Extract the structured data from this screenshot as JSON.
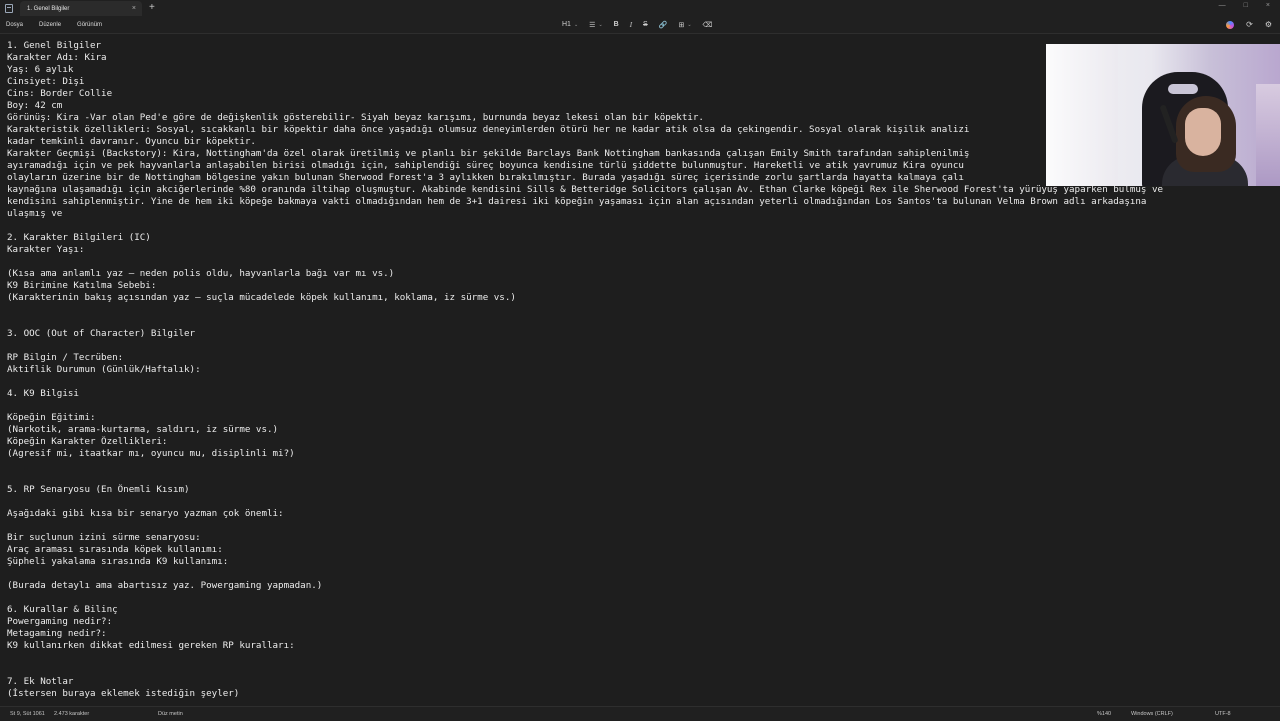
{
  "window": {
    "tab_title": "1. Genel Bilgiler",
    "tab_close": "×",
    "new_tab": "+",
    "controls": [
      "—",
      "□",
      "×"
    ]
  },
  "menu": [
    "Dosya",
    "Düzenle",
    "Görünüm"
  ],
  "toolbar": {
    "heading": "H1",
    "list": "☰",
    "bold": "B",
    "italic": "I",
    "strike": "S",
    "link": "🔗",
    "table": "⊞",
    "clear": "⌫",
    "chevron": "⌄"
  },
  "right_tools": [
    "⟳",
    "⚙"
  ],
  "document": {
    "lines": [
      "1. Genel Bilgiler",
      "Karakter Adı: Kira",
      "Yaş: 6 aylık",
      "Cinsiyet: Dişi",
      "Cins: Border Collie",
      "Boy: 42 cm",
      "Görünüş: Kira -Var olan Ped'e göre de değişkenlik gösterebilir- Siyah beyaz karışımı, burnunda beyaz lekesi olan bir köpektir.",
      "Karakteristik özellikleri: Sosyal, sıcakkanlı bir köpektir daha önce yaşadığı olumsuz deneyimlerden ötürü her ne kadar atik olsa da çekingendir. Sosyal olarak kişilik analizi",
      "kadar temkinli davranır. Oyuncu bir köpektir.",
      "Karakter Geçmişi (Backstory): Kira, Nottingham'da özel olarak üretilmiş ve planlı bir şekilde Barclays Bank Nottingham bankasında çalışan Emily Smith tarafından sahiplenilmiş",
      "ayıramadığı için ve pek hayvanlarla anlaşabilen birisi olmadığı için, sahiplendiği süreç boyunca kendisine türlü şiddette bulunmuştur. Hareketli ve atik yavrumuz Kira oyuncu",
      "olayların üzerine bir de Nottingham bölgesine yakın bulunan Sherwood Forest'a 3 aylıkken bırakılmıştır. Burada yaşadığı süreç içerisinde zorlu şartlarda hayatta kalmaya çalı",
      "kaynağına ulaşamadığı için akciğerlerinde %80 oranında iltihap oluşmuştur. Akabinde kendisini Sills & Betteridge Solicitors çalışan Av. Ethan Clarke köpeği Rex ile Sherwood Forest'ta yürüyüş yaparken bulmuş ve",
      "kendisini sahiplenmiştir. Yine de hem iki köpeğe bakmaya vakti olmadığından hem de 3+1 dairesi iki köpeğin yaşaması için alan açısından yeterli olmadığından Los Santos'ta bulunan Velma Brown adlı arkadaşına",
      "ulaşmış ve",
      "",
      "2. Karakter Bilgileri (IC)",
      "Karakter Yaşı:",
      "",
      "(Kısa ama anlamlı yaz — neden polis oldu, hayvanlarla bağı var mı vs.)",
      "K9 Birimine Katılma Sebebi:",
      "(Karakterinin bakış açısından yaz — suçla mücadelede köpek kullanımı, koklama, iz sürme vs.)",
      "",
      "",
      "3. OOC (Out of Character) Bilgiler",
      "",
      "RP Bilgin / Tecrüben:",
      "Aktiflik Durumun (Günlük/Haftalık):",
      "",
      "4. K9 Bilgisi",
      "",
      "Köpeğin Eğitimi:",
      "(Narkotik, arama-kurtarma, saldırı, iz sürme vs.)",
      "Köpeğin Karakter Özellikleri:",
      "(Agresif mi, itaatkar mı, oyuncu mu, disiplinli mi?)",
      "",
      "",
      "5. RP Senaryosu (En Önemli Kısım)",
      "",
      "Aşağıdaki gibi kısa bir senaryo yazman çok önemli:",
      "",
      "Bir suçlunun izini sürme senaryosu:",
      "Araç araması sırasında köpek kullanımı:",
      "Şüpheli yakalama sırasında K9 kullanımı:",
      "",
      "(Burada detaylı ama abartısız yaz. Powergaming yapmadan.)",
      "",
      "6. Kurallar & Bilinç",
      "Powergaming nedir?:",
      "Metagaming nedir?:",
      "K9 kullanırken dikkat edilmesi gereken RP kuralları:",
      "",
      "",
      "7. Ek Notlar",
      "(İstersen buraya eklemek istediğin şeyler)"
    ]
  },
  "status": {
    "position": "St 9, Süt 1061",
    "chars": "2.473 karakter",
    "format": "Düz metin",
    "zoom": "%140",
    "line_ending": "Windows (CRLF)",
    "encoding": "UTF-8"
  }
}
